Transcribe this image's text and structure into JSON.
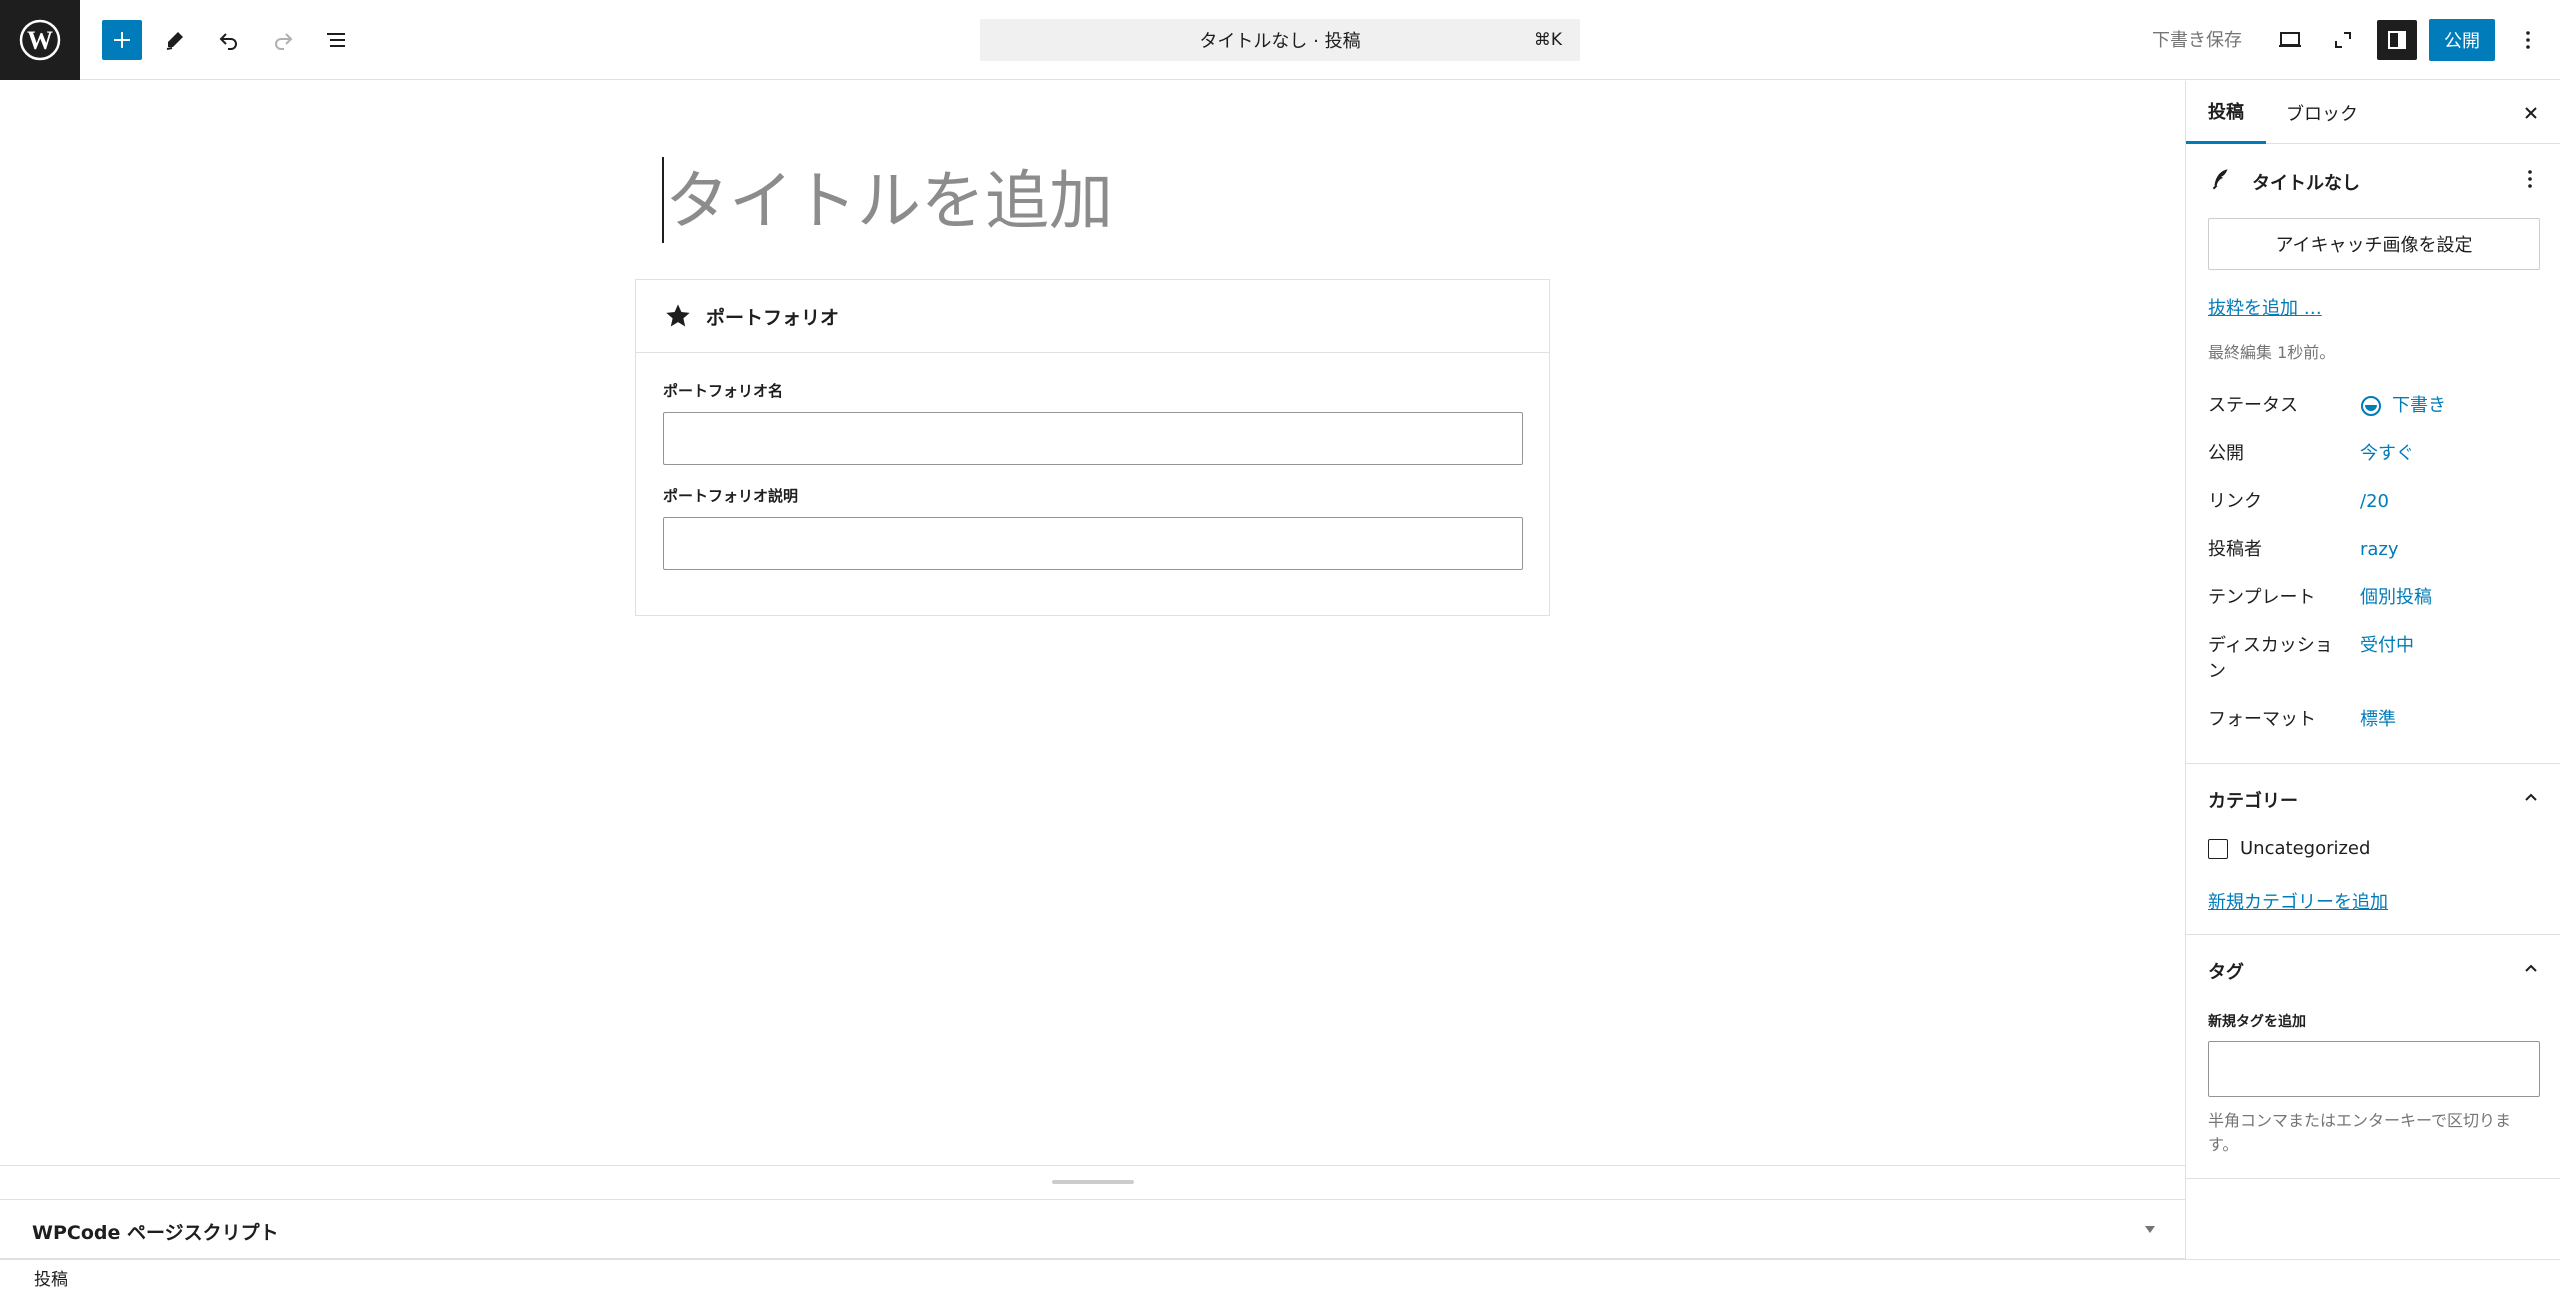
{
  "topbar": {
    "command_center": "タイトルなし · 投稿",
    "shortcut": "⌘K",
    "save_draft": "下書き保存",
    "publish": "公開"
  },
  "editor": {
    "title_placeholder": "タイトルを追加",
    "meta_box": {
      "title": "ポートフォリオ",
      "fields": [
        {
          "label": "ポートフォリオ名",
          "value": ""
        },
        {
          "label": "ポートフォリオ説明",
          "value": ""
        }
      ]
    },
    "wpcode_panel": "WPCode ページスクリプト",
    "footer_breadcrumb": "投稿"
  },
  "sidebar": {
    "tabs": [
      {
        "label": "投稿",
        "active": true
      },
      {
        "label": "ブロック",
        "active": false
      }
    ],
    "post_title": "タイトルなし",
    "featured_image_button": "アイキャッチ画像を設定",
    "excerpt_link": "抜粋を追加 …",
    "last_edited": "最終編集 1秒前。",
    "rows": [
      {
        "label": "ステータス",
        "value": "下書き"
      },
      {
        "label": "公開",
        "value": "今すぐ"
      },
      {
        "label": "リンク",
        "value": "/20"
      },
      {
        "label": "投稿者",
        "value": "razy"
      },
      {
        "label": "テンプレート",
        "value": "個別投稿"
      },
      {
        "label": "ディスカッション",
        "value": "受付中"
      },
      {
        "label": "フォーマット",
        "value": "標準"
      }
    ],
    "categories": {
      "title": "カテゴリー",
      "items": [
        {
          "label": "Uncategorized",
          "checked": false
        }
      ],
      "add_link": "新規カテゴリーを追加"
    },
    "tags": {
      "title": "タグ",
      "input_label": "新規タグを追加",
      "help": "半角コンマまたはエンターキーで区切ります。"
    }
  },
  "colors": {
    "accent": "#007cba",
    "dark": "#1e1e1e",
    "muted": "#757575",
    "border": "#e0e0e0"
  }
}
